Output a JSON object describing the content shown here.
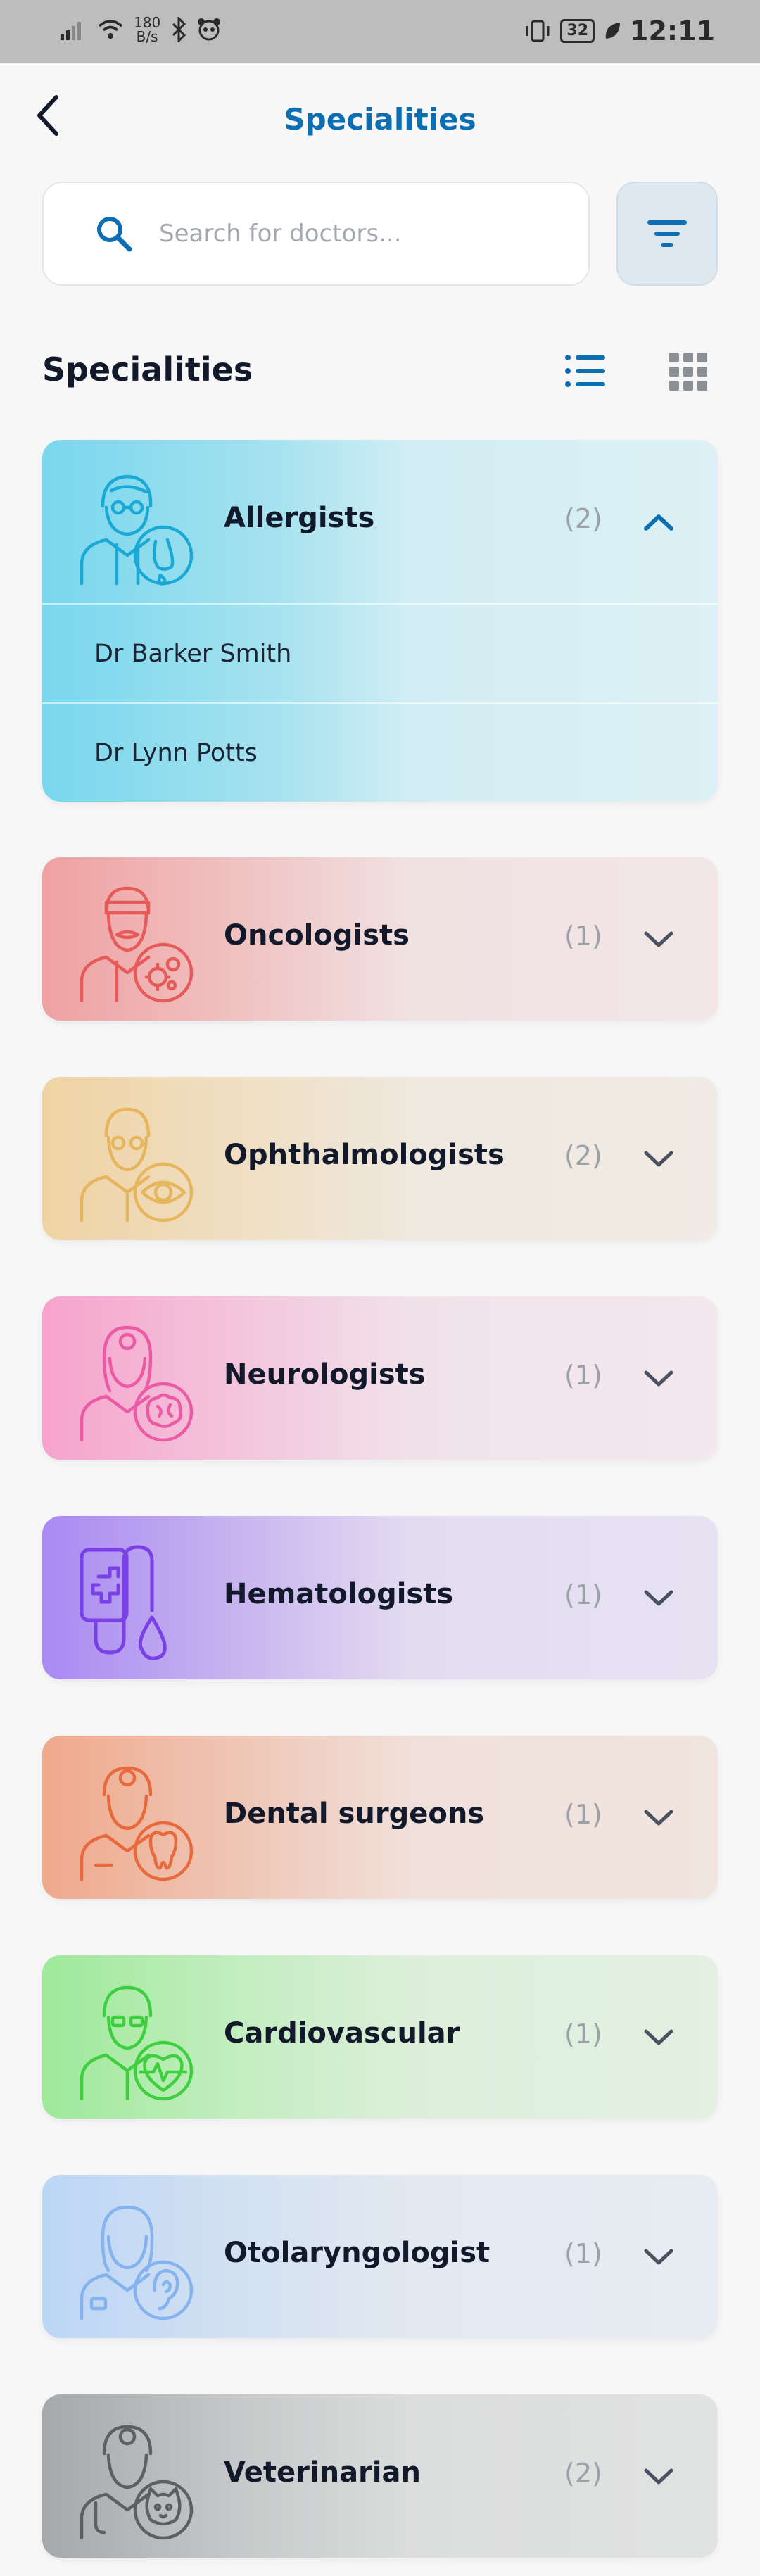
{
  "status_bar": {
    "speed_value": "180",
    "speed_unit": "B/s",
    "battery": "32",
    "time": "12:11"
  },
  "header": {
    "title": "Specialities"
  },
  "search": {
    "placeholder": "Search for doctors..."
  },
  "section": {
    "title": "Specialities"
  },
  "colors": {
    "accent": "#0c6fb4",
    "allergists": "#3bbfe0",
    "oncologists": "#ec6b6b",
    "ophthalmologists": "#e9bf72",
    "neurologists": "#f16eb0",
    "hematologists": "#8b5cf0",
    "dental": "#ec7b4e",
    "cardiovascular": "#5bdc5a",
    "otolaryngologist": "#89b9f4",
    "veterinarian": "#6f7478"
  },
  "specialities": [
    {
      "label": "Allergists",
      "count": "(2)",
      "icon": "allergist-doctor-icon",
      "expanded": true,
      "doctors": [
        "Dr Barker Smith",
        "Dr Lynn Potts"
      ]
    },
    {
      "label": "Oncologists",
      "count": "(1)",
      "icon": "oncologist-doctor-icon",
      "expanded": false
    },
    {
      "label": "Ophthalmologists",
      "count": "(2)",
      "icon": "ophthalmologist-doctor-icon",
      "expanded": false
    },
    {
      "label": "Neurologists",
      "count": "(1)",
      "icon": "neurologist-doctor-icon",
      "expanded": false
    },
    {
      "label": "Hematologists",
      "count": "(1)",
      "icon": "iv-drip-blood-icon",
      "expanded": false
    },
    {
      "label": "Dental surgeons",
      "count": "(1)",
      "icon": "dentist-doctor-icon",
      "expanded": false
    },
    {
      "label": "Cardiovascular",
      "count": "(1)",
      "icon": "cardiologist-doctor-icon",
      "expanded": false
    },
    {
      "label": "Otolaryngologist",
      "count": "(1)",
      "icon": "ent-doctor-icon",
      "expanded": false
    },
    {
      "label": "Veterinarian",
      "count": "(2)",
      "icon": "veterinarian-doctor-icon",
      "expanded": false
    }
  ]
}
